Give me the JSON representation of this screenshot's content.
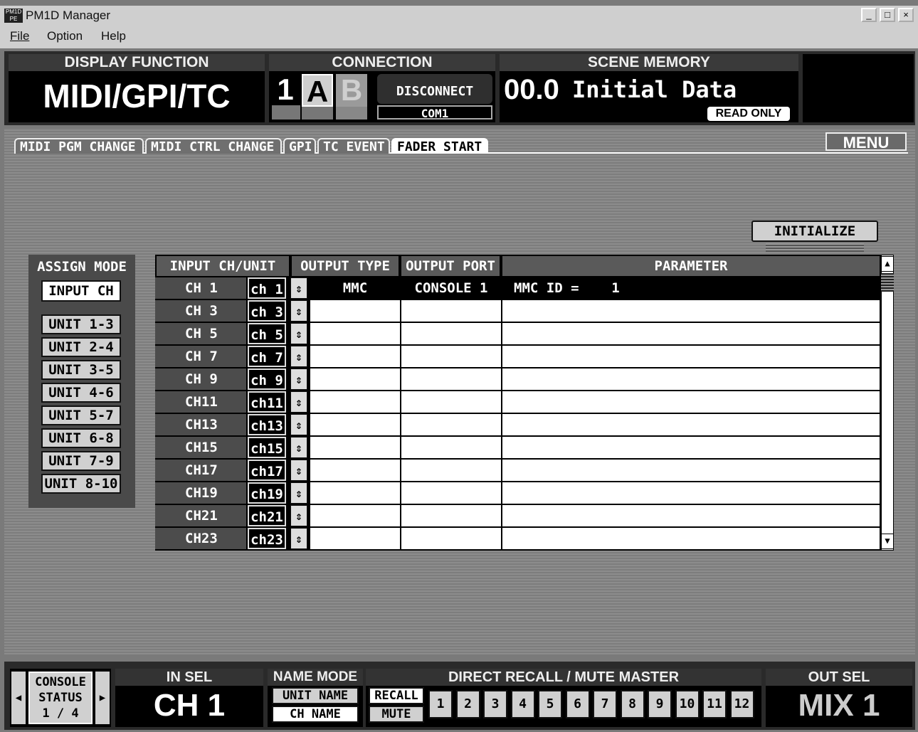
{
  "window": {
    "app_icon": "PM1D\nPE",
    "title": "PM1D Manager",
    "minimize": "_",
    "maximize": "□",
    "close": "×"
  },
  "menu": [
    {
      "label": "File"
    },
    {
      "label": "Option"
    },
    {
      "label": "Help"
    }
  ],
  "display_function": {
    "header": "DISPLAY FUNCTION",
    "value": "MIDI/GPI/TC"
  },
  "connection": {
    "header": "CONNECTION",
    "number": "1",
    "a": "A",
    "b": "B",
    "status": "DISCONNECT",
    "port": "COM1"
  },
  "scene_memory": {
    "header": "SCENE MEMORY",
    "number": "00.0",
    "name": "Initial Data",
    "badge": "READ ONLY"
  },
  "tabs": [
    {
      "label": "MIDI PGM CHANGE"
    },
    {
      "label": "MIDI CTRL CHANGE"
    },
    {
      "label": "GPI"
    },
    {
      "label": "TC EVENT"
    },
    {
      "label": "FADER START"
    }
  ],
  "menu_button": "MENU",
  "initialize_button": "INITIALIZE",
  "assign_mode": {
    "title": "ASSIGN MODE",
    "buttons": [
      {
        "label": "INPUT CH"
      },
      {
        "label": "UNIT 1-3"
      },
      {
        "label": "UNIT 2-4"
      },
      {
        "label": "UNIT 3-5"
      },
      {
        "label": "UNIT 4-6"
      },
      {
        "label": "UNIT 5-7"
      },
      {
        "label": "UNIT 6-8"
      },
      {
        "label": "UNIT 7-9"
      },
      {
        "label": "UNIT 8-10"
      }
    ]
  },
  "table": {
    "headers": {
      "input": "INPUT CH/UNIT",
      "output_type": "OUTPUT TYPE",
      "output_port": "OUTPUT PORT",
      "parameter": "PARAMETER"
    },
    "spin_glyph": "⇕",
    "rows": [
      {
        "ch": "CH 1",
        "box": "ch 1",
        "type": "MMC",
        "port": "CONSOLE 1",
        "param": "MMC ID =    1"
      },
      {
        "ch": "CH 3",
        "box": "ch 3",
        "type": "",
        "port": "",
        "param": ""
      },
      {
        "ch": "CH 5",
        "box": "ch 5",
        "type": "",
        "port": "",
        "param": ""
      },
      {
        "ch": "CH 7",
        "box": "ch 7",
        "type": "",
        "port": "",
        "param": ""
      },
      {
        "ch": "CH 9",
        "box": "ch 9",
        "type": "",
        "port": "",
        "param": ""
      },
      {
        "ch": "CH11",
        "box": "ch11",
        "type": "",
        "port": "",
        "param": ""
      },
      {
        "ch": "CH13",
        "box": "ch13",
        "type": "",
        "port": "",
        "param": ""
      },
      {
        "ch": "CH15",
        "box": "ch15",
        "type": "",
        "port": "",
        "param": ""
      },
      {
        "ch": "CH17",
        "box": "ch17",
        "type": "",
        "port": "",
        "param": ""
      },
      {
        "ch": "CH19",
        "box": "ch19",
        "type": "",
        "port": "",
        "param": ""
      },
      {
        "ch": "CH21",
        "box": "ch21",
        "type": "",
        "port": "",
        "param": ""
      },
      {
        "ch": "CH23",
        "box": "ch23",
        "type": "",
        "port": "",
        "param": ""
      }
    ]
  },
  "bottom": {
    "console_status": {
      "line1": "CONSOLE",
      "line2": "STATUS",
      "line3": "1 / 4",
      "left": "◀",
      "right": "▶"
    },
    "in_sel": {
      "header": "IN SEL",
      "value": "CH 1"
    },
    "name_mode": {
      "header": "NAME MODE",
      "unit_name": "UNIT NAME",
      "ch_name": "CH NAME"
    },
    "direct_recall": {
      "header": "DIRECT RECALL / MUTE MASTER",
      "recall": "RECALL",
      "mute": "MUTE",
      "numbers": [
        "1",
        "2",
        "3",
        "4",
        "5",
        "6",
        "7",
        "8",
        "9",
        "10",
        "11",
        "12"
      ]
    },
    "out_sel": {
      "header": "OUT SEL",
      "value": "MIX 1"
    }
  }
}
